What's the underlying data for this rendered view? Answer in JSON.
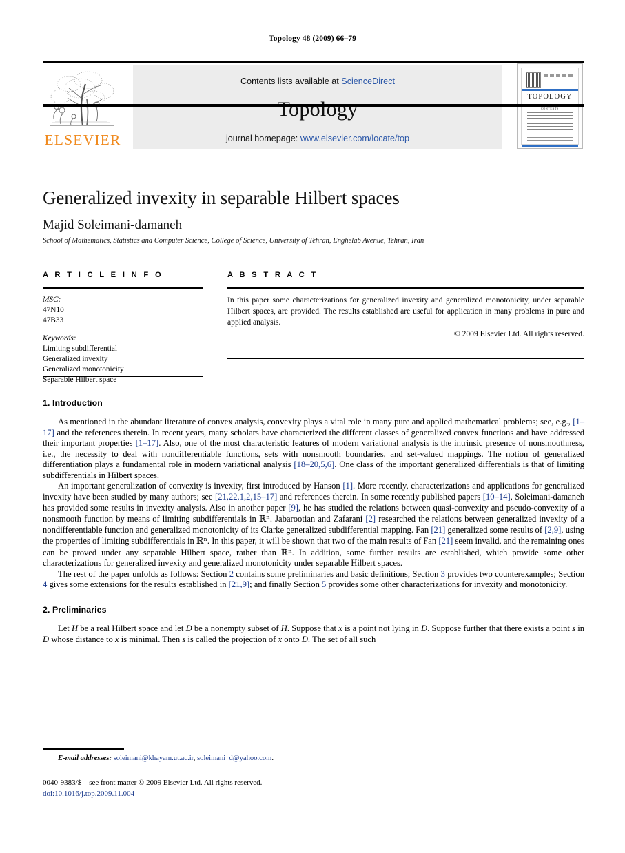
{
  "running_head": "Topology 48 (2009) 66–79",
  "masthead": {
    "contents_prefix": "Contents lists available at ",
    "contents_link": "ScienceDirect",
    "journal_title": "Topology",
    "homepage_prefix": "journal homepage: ",
    "homepage_link": "www.elsevier.com/locate/top",
    "publisher_wordmark": "ELSEVIER",
    "cover_title": "TOPOLOGY",
    "cover_contents_label": "CONTENTS"
  },
  "title_block": {
    "title": "Generalized invexity in separable Hilbert spaces",
    "author": "Majid Soleimani-damaneh",
    "affiliation": "School of Mathematics, Statistics and Computer Science, College of Science, University of Tehran, Enghelab Avenue, Tehran, Iran"
  },
  "article_info": {
    "heading": "A R T I C L E   I N F O",
    "msc_label": "MSC:",
    "msc_codes": [
      "47N10",
      "47B33"
    ],
    "keywords_label": "Keywords:",
    "keywords": [
      "Limiting subdifferential",
      "Generalized invexity",
      "Generalized monotonicity",
      "Separable Hilbert space"
    ]
  },
  "abstract": {
    "heading": "A B S T R A C T",
    "text": "In this paper some characterizations for generalized invexity and generalized monotonicity, under separable Hilbert spaces, are provided. The results established are useful for application in many problems in pure and applied analysis.",
    "copyright": "© 2009 Elsevier Ltd. All rights reserved."
  },
  "sections": {
    "intro_heading": "1.  Introduction",
    "prelim_heading": "2.  Preliminaries",
    "intro_p1_a": "As mentioned in the abundant literature of convex analysis, convexity plays a vital role in many pure and applied mathematical problems; see, e.g., ",
    "intro_p1_ref1": "[1–17]",
    "intro_p1_b": " and the references therein. In recent years, many scholars have characterized the different classes of generalized convex functions and have addressed their important properties ",
    "intro_p1_ref2": "[1–17]",
    "intro_p1_c": ". Also, one of the most characteristic features of modern variational analysis is the intrinsic presence of nonsmoothness, i.e., the necessity to deal with nondifferentiable functions, sets with nonsmooth boundaries, and set-valued mappings. The notion of generalized differentiation plays a fundamental role in modern variational analysis ",
    "intro_p1_ref3": "[18–20,5,6]",
    "intro_p1_d": ". One class of the important generalized differentials is that of limiting subdifferentials in Hilbert spaces.",
    "intro_p2_a": "An important generalization of convexity is invexity, first introduced by Hanson ",
    "intro_p2_ref1": "[1]",
    "intro_p2_b": ". More recently, characterizations and applications for generalized invexity have been studied by many authors; see ",
    "intro_p2_ref2": "[21,22,1,2,15–17]",
    "intro_p2_c": " and references therein. In some recently published papers ",
    "intro_p2_ref3": "[10–14]",
    "intro_p2_d": ", Soleimani-damaneh has provided some results in invexity analysis. Also in another paper ",
    "intro_p2_ref4": "[9]",
    "intro_p2_e": ", he has studied the relations between quasi-convexity and pseudo-convexity of a nonsmooth function by means of limiting subdifferentials in ",
    "intro_p2_math1": "ℝⁿ",
    "intro_p2_f": ". Jabarootian and Zafarani ",
    "intro_p2_ref5": "[2]",
    "intro_p2_g": " researched the relations between generalized invexity of a nondifferentiable function and generalized monotonicity of its Clarke generalized subdifferential mapping. Fan ",
    "intro_p2_ref6": "[21]",
    "intro_p2_h": " generalized some results of ",
    "intro_p2_ref7": "[2,9]",
    "intro_p2_i": ", using the properties of limiting subdifferentials in ",
    "intro_p2_math2": "ℝⁿ",
    "intro_p2_j": ". In this paper, it will be shown that two of the main results of Fan ",
    "intro_p2_ref8": "[21]",
    "intro_p2_k": " seem invalid, and the remaining ones can be proved under any separable Hilbert space, rather than ",
    "intro_p2_math3": "ℝⁿ",
    "intro_p2_l": ". In addition, some further results are established, which provide some other characterizations for generalized invexity and generalized monotonicity under separable Hilbert spaces.",
    "intro_p3_a": "The rest of the paper unfolds as follows: Section ",
    "intro_p3_sec2": "2",
    "intro_p3_b": " contains some preliminaries and basic definitions; Section ",
    "intro_p3_sec3": "3",
    "intro_p3_c": " provides two counterexamples; Section ",
    "intro_p3_sec4": "4",
    "intro_p3_d": " gives some extensions for the results established in ",
    "intro_p3_ref": "[21,9]",
    "intro_p3_e": "; and finally Section ",
    "intro_p3_sec5": "5",
    "intro_p3_f": " provides some other characterizations for invexity and monotonicity.",
    "prelim_p1_a": "Let ",
    "prelim_var_H": "H",
    "prelim_p1_b": " be a real Hilbert space and let ",
    "prelim_var_D": "D",
    "prelim_p1_c": " be a nonempty subset of ",
    "prelim_var_H2": "H",
    "prelim_p1_d": ". Suppose that ",
    "prelim_var_x": "x",
    "prelim_p1_e": " is a point not lying in ",
    "prelim_var_D2": "D",
    "prelim_p1_f": ". Suppose further that there exists a point ",
    "prelim_var_s": "s",
    "prelim_p1_g": " in ",
    "prelim_var_D3": "D",
    "prelim_p1_h": " whose distance to ",
    "prelim_var_x2": "x",
    "prelim_p1_i": " is minimal. Then ",
    "prelim_var_s2": "s",
    "prelim_p1_j": " is called the projection of ",
    "prelim_var_x3": "x",
    "prelim_p1_k": " onto ",
    "prelim_var_D4": "D",
    "prelim_p1_l": ". The set of all such"
  },
  "footer": {
    "email_label": "E-mail addresses:",
    "email_1": "soleimani@khayam.ut.ac.ir",
    "email_sep": ", ",
    "email_2": "soleimani_d@yahoo.com",
    "email_end": ".",
    "imprint_line": "0040-9383/$ – see front matter © 2009 Elsevier Ltd. All rights reserved.",
    "doi": "doi:10.1016/j.top.2009.11.004"
  },
  "colors": {
    "link_blue": "#2b57a8",
    "ref_blue": "#1b3a8c",
    "elsevier_orange": "#f08a1e",
    "banner_gray": "#ececec"
  }
}
